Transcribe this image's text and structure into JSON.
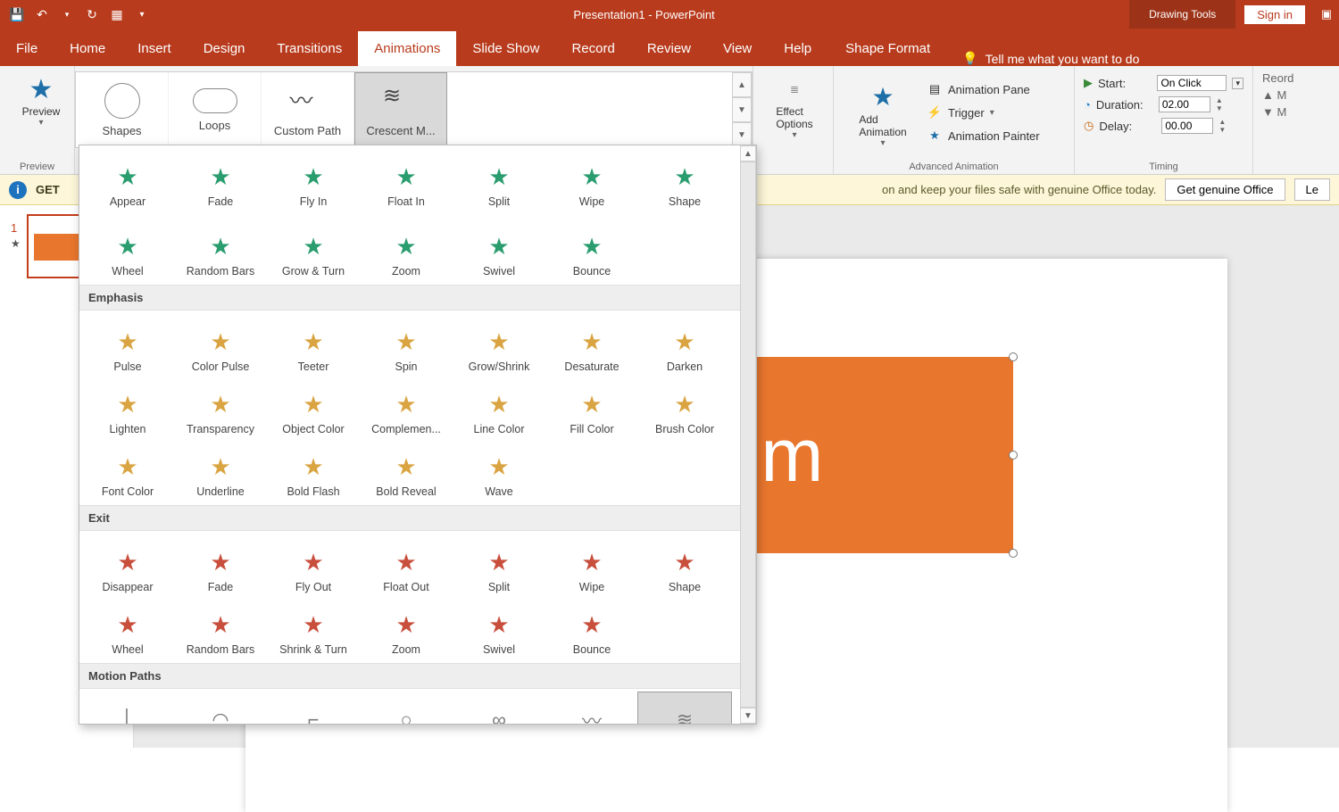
{
  "app": {
    "title": "Presentation1  -  PowerPoint",
    "contextTab": "Drawing Tools",
    "signIn": "Sign in"
  },
  "qat": {
    "save": "💾",
    "undo": "↶",
    "redo": "↻",
    "present": "▦",
    "more": "▾"
  },
  "tabs": [
    "File",
    "Home",
    "Insert",
    "Design",
    "Transitions",
    "Animations",
    "Slide Show",
    "Record",
    "Review",
    "View",
    "Help"
  ],
  "activeTab": "Animations",
  "shapeFormat": "Shape Format",
  "tellMe": "Tell me what you want to do",
  "ribbon": {
    "preview": {
      "label": "Preview",
      "group": "Preview"
    },
    "galleryRow": [
      {
        "label": "Shapes"
      },
      {
        "label": "Loops"
      },
      {
        "label": "Custom Path"
      },
      {
        "label": "Crescent M...",
        "selected": true
      }
    ],
    "effectOptions": "Effect\nOptions",
    "addAnimation": "Add\nAnimation",
    "advAnim": {
      "pane": "Animation Pane",
      "trigger": "Trigger",
      "painter": "Animation Painter",
      "group": "Advanced Animation"
    },
    "timing": {
      "startLbl": "Start:",
      "startVal": "On Click",
      "durLbl": "Duration:",
      "durVal": "02.00",
      "delayLbl": "Delay:",
      "delayVal": "00.00",
      "reorder": "Reord",
      "moveEarlier": "M",
      "moveLater": "M",
      "group": "Timing"
    }
  },
  "msgbar": {
    "leading": "GET",
    "trailing": "on and keep your files safe with genuine Office today.",
    "btn1": "Get genuine Office",
    "btn2": "Le"
  },
  "slide": {
    "number": "1",
    "shapeText": "forum"
  },
  "gallery": {
    "entranceRow1": [
      "Appear",
      "Fade",
      "Fly In",
      "Float In",
      "Split",
      "Wipe",
      "Shape"
    ],
    "entranceRow2": [
      "Wheel",
      "Random Bars",
      "Grow & Turn",
      "Zoom",
      "Swivel",
      "Bounce"
    ],
    "emphasisHdr": "Emphasis",
    "emphasis": [
      "Pulse",
      "Color Pulse",
      "Teeter",
      "Spin",
      "Grow/Shrink",
      "Desaturate",
      "Darken",
      "Lighten",
      "Transparency",
      "Object Color",
      "Complemen...",
      "Line Color",
      "Fill Color",
      "Brush Color",
      "Font Color",
      "Underline",
      "Bold Flash",
      "Bold Reveal",
      "Wave"
    ],
    "exitHdr": "Exit",
    "exit": [
      "Disappear",
      "Fade",
      "Fly Out",
      "Float Out",
      "Split",
      "Wipe",
      "Shape",
      "Wheel",
      "Random Bars",
      "Shrink & Turn",
      "Zoom",
      "Swivel",
      "Bounce"
    ],
    "motionHdr": "Motion Paths",
    "motion": [
      "Lines",
      "Arcs",
      "Turns",
      "Shapes",
      "Loops",
      "Custom Path",
      "Crescent M..."
    ],
    "motionSelected": "Crescent M..."
  }
}
